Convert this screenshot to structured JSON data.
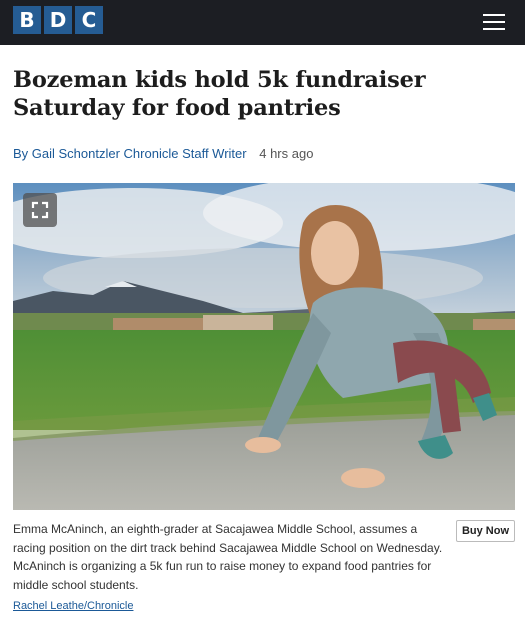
{
  "header": {
    "logo_letters": [
      "B",
      "D",
      "C"
    ],
    "logo_color": "#255c93",
    "bar_color": "#1c1e23",
    "menu_icon": "hamburger-menu-icon"
  },
  "article": {
    "headline": "Bozeman kids hold 5k fundraiser Saturday for food pantries",
    "byline_author": "By Gail Schontzler Chronicle Staff Writer",
    "byline_time": "4 hrs ago",
    "link_color": "#1b5997"
  },
  "photo": {
    "expand_icon": "expand-fullscreen-icon",
    "caption": "Emma McAninch, an eighth-grader at Sacajawea Middle School, assumes a racing position on the dirt track behind Sacajawea Middle School on Wednesday. McAninch is organizing a 5k fun run to raise money to expand food pantries for middle school students.",
    "buy_now_label": "Buy Now",
    "credit": "Rachel Leathe/Chronicle"
  }
}
